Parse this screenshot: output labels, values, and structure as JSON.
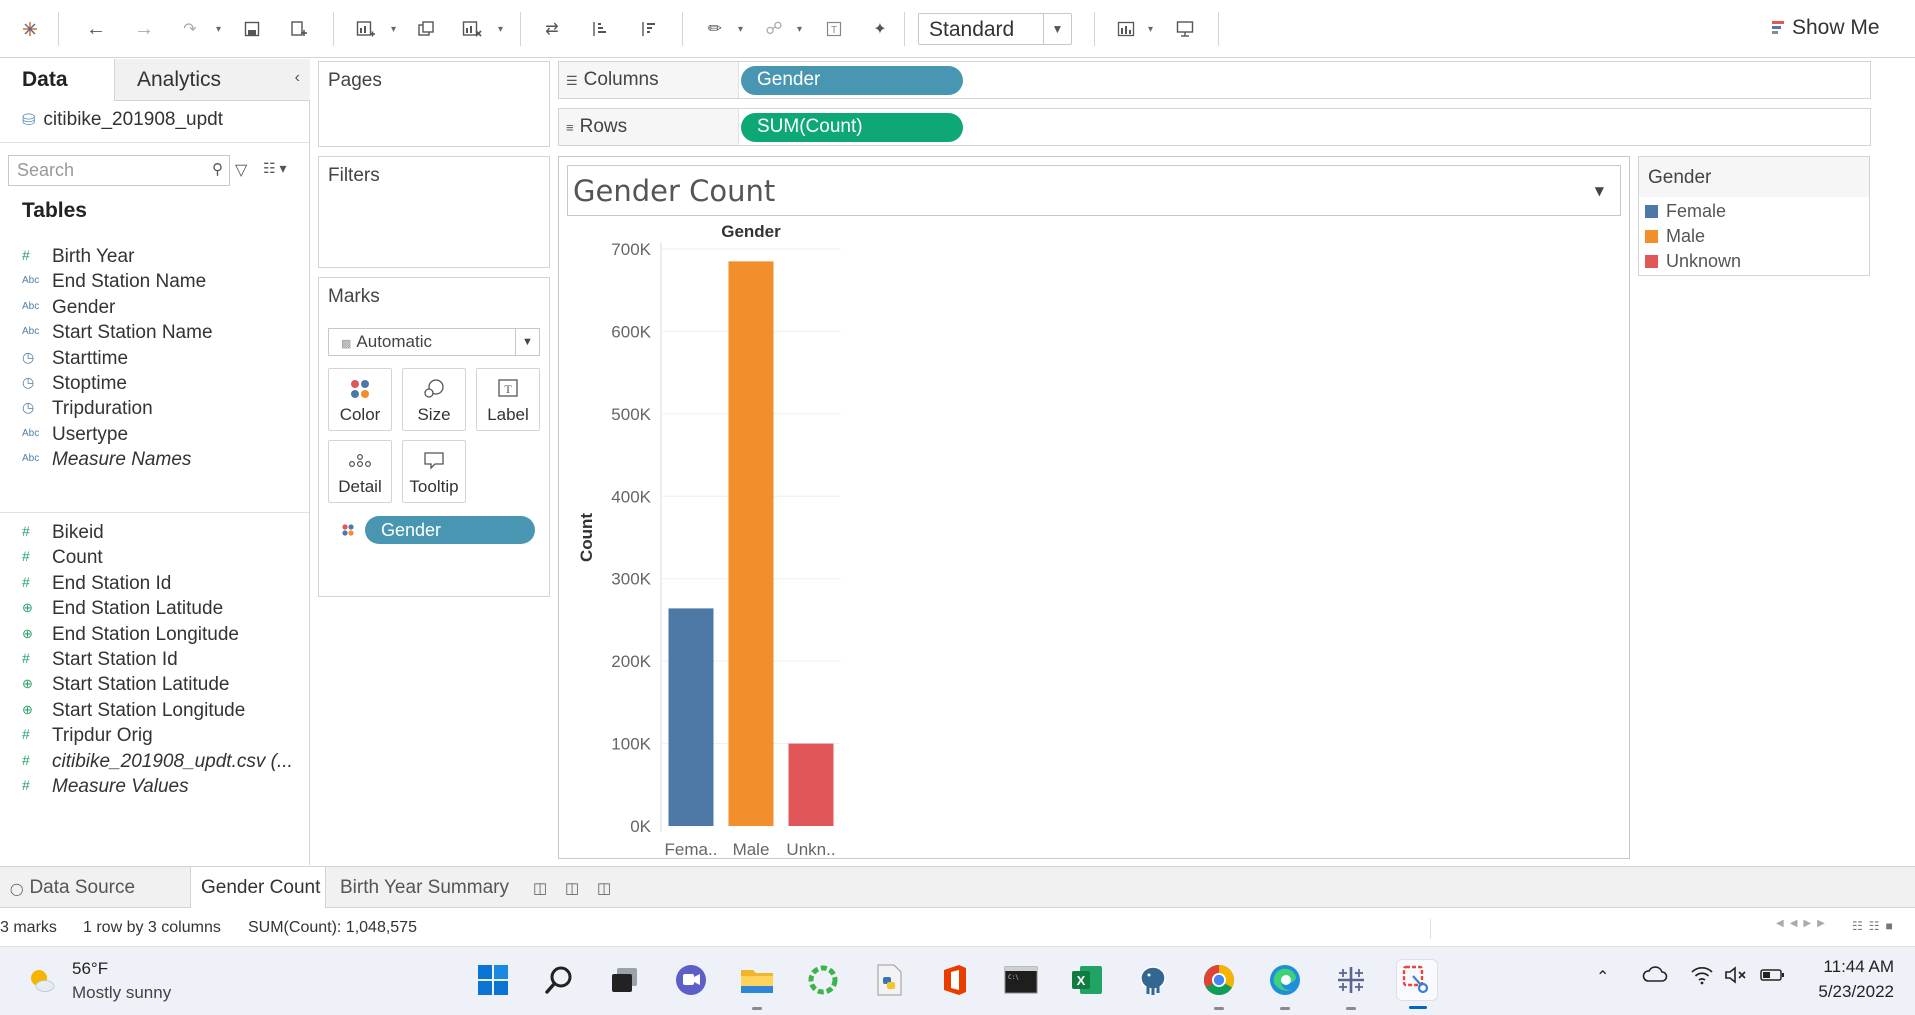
{
  "toolbar": {
    "view_mode": "Standard",
    "show_me": "Show Me",
    "icons": [
      "tableau-logo-icon",
      "undo-icon",
      "redo-icon",
      "replay-icon",
      "save-icon",
      "new-datasource-icon",
      "new-worksheet-icon",
      "duplicate-icon",
      "clear-sheet-icon",
      "swap-icon",
      "sort-asc-icon",
      "sort-desc-icon",
      "highlight-icon",
      "group-icon",
      "label-icon",
      "pin-icon",
      "show-cards-icon",
      "presentation-icon"
    ]
  },
  "data_pane": {
    "tab_data": "Data",
    "tab_analytics": "Analytics",
    "datasource": "citibike_201908_updt",
    "search_placeholder": "Search",
    "tables_heading": "Tables",
    "dimensions": [
      {
        "type": "#",
        "name": "Birth Year",
        "italic": false
      },
      {
        "type": "Abc",
        "name": "End Station Name",
        "italic": false
      },
      {
        "type": "Abc",
        "name": "Gender",
        "italic": false
      },
      {
        "type": "Abc",
        "name": "Start Station Name",
        "italic": false
      },
      {
        "type": "date",
        "name": "Starttime",
        "italic": false
      },
      {
        "type": "date",
        "name": "Stoptime",
        "italic": false
      },
      {
        "type": "date",
        "name": "Tripduration",
        "italic": false
      },
      {
        "type": "Abc",
        "name": "Usertype",
        "italic": false
      },
      {
        "type": "Abc",
        "name": "Measure Names",
        "italic": true
      }
    ],
    "measures": [
      {
        "type": "#",
        "name": "Bikeid",
        "italic": false
      },
      {
        "type": "#",
        "name": "Count",
        "italic": false
      },
      {
        "type": "#",
        "name": "End Station Id",
        "italic": false
      },
      {
        "type": "geo",
        "name": "End Station Latitude",
        "italic": false
      },
      {
        "type": "geo",
        "name": "End Station Longitude",
        "italic": false
      },
      {
        "type": "#",
        "name": "Start Station Id",
        "italic": false
      },
      {
        "type": "geo",
        "name": "Start Station Latitude",
        "italic": false
      },
      {
        "type": "geo",
        "name": "Start Station Longitude",
        "italic": false
      },
      {
        "type": "#",
        "name": "Tripdur Orig",
        "italic": false
      },
      {
        "type": "#",
        "name": "citibike_201908_updt.csv (...",
        "italic": true
      },
      {
        "type": "#",
        "name": "Measure Values",
        "italic": true
      }
    ]
  },
  "cards": {
    "pages": "Pages",
    "filters": "Filters",
    "marks": "Marks",
    "mark_type": "Automatic",
    "mark_buttons": [
      "Color",
      "Size",
      "Label",
      "Detail",
      "Tooltip"
    ],
    "marks_pill": "Gender"
  },
  "shelves": {
    "columns_label": "Columns",
    "columns_pill": "Gender",
    "rows_label": "Rows",
    "rows_pill": "SUM(Count)"
  },
  "view": {
    "title": "Gender Count"
  },
  "chart_data": {
    "type": "bar",
    "header": "Gender",
    "categories": [
      "Fema..",
      "Male",
      "Unkn.."
    ],
    "values": [
      264000,
      685000,
      100000
    ],
    "colors": [
      "#4e79a7",
      "#f28e2b",
      "#e15759"
    ],
    "ylabel": "Count",
    "ylim": [
      0,
      700000
    ],
    "yticks": [
      "0K",
      "100K",
      "200K",
      "300K",
      "400K",
      "500K",
      "600K",
      "700K"
    ],
    "grid": true
  },
  "legend": {
    "title": "Gender",
    "items": [
      {
        "label": "Female",
        "color": "#4e79a7"
      },
      {
        "label": "Male",
        "color": "#f28e2b"
      },
      {
        "label": "Unknown",
        "color": "#e15759"
      }
    ]
  },
  "sheet_tabs": {
    "datasource": "Data Source",
    "active": "Gender Count",
    "other": "Birth Year Summary"
  },
  "status": {
    "marks": "3 marks",
    "dims": "1 row by 3 columns",
    "sum": "SUM(Count): 1,048,575"
  },
  "taskbar": {
    "temp": "56°F",
    "weather": "Mostly sunny",
    "time": "11:44 AM",
    "date": "5/23/2022",
    "apps": [
      "windows-start-icon",
      "search-icon",
      "task-view-icon",
      "teams-chat-icon",
      "file-explorer-icon",
      "app-ring-icon",
      "python-file-icon",
      "office-icon",
      "terminal-icon",
      "excel-icon",
      "postgres-icon",
      "chrome-icon",
      "edge-icon",
      "tableau-icon",
      "snipping-tool-icon"
    ]
  }
}
